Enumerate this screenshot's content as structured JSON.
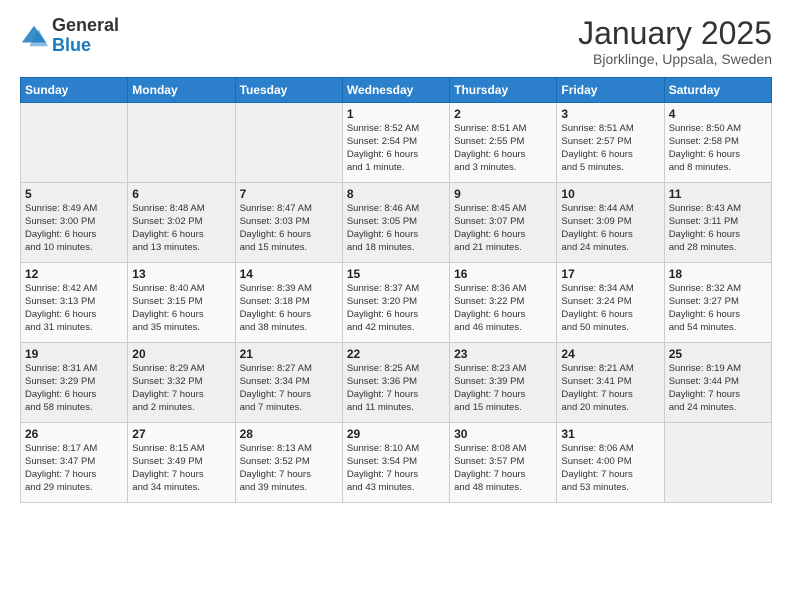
{
  "logo": {
    "general": "General",
    "blue": "Blue"
  },
  "header": {
    "title": "January 2025",
    "subtitle": "Bjorklinge, Uppsala, Sweden"
  },
  "days_of_week": [
    "Sunday",
    "Monday",
    "Tuesday",
    "Wednesday",
    "Thursday",
    "Friday",
    "Saturday"
  ],
  "weeks": [
    [
      {
        "day": "",
        "info": ""
      },
      {
        "day": "",
        "info": ""
      },
      {
        "day": "",
        "info": ""
      },
      {
        "day": "1",
        "info": "Sunrise: 8:52 AM\nSunset: 2:54 PM\nDaylight: 6 hours\nand 1 minute."
      },
      {
        "day": "2",
        "info": "Sunrise: 8:51 AM\nSunset: 2:55 PM\nDaylight: 6 hours\nand 3 minutes."
      },
      {
        "day": "3",
        "info": "Sunrise: 8:51 AM\nSunset: 2:57 PM\nDaylight: 6 hours\nand 5 minutes."
      },
      {
        "day": "4",
        "info": "Sunrise: 8:50 AM\nSunset: 2:58 PM\nDaylight: 6 hours\nand 8 minutes."
      }
    ],
    [
      {
        "day": "5",
        "info": "Sunrise: 8:49 AM\nSunset: 3:00 PM\nDaylight: 6 hours\nand 10 minutes."
      },
      {
        "day": "6",
        "info": "Sunrise: 8:48 AM\nSunset: 3:02 PM\nDaylight: 6 hours\nand 13 minutes."
      },
      {
        "day": "7",
        "info": "Sunrise: 8:47 AM\nSunset: 3:03 PM\nDaylight: 6 hours\nand 15 minutes."
      },
      {
        "day": "8",
        "info": "Sunrise: 8:46 AM\nSunset: 3:05 PM\nDaylight: 6 hours\nand 18 minutes."
      },
      {
        "day": "9",
        "info": "Sunrise: 8:45 AM\nSunset: 3:07 PM\nDaylight: 6 hours\nand 21 minutes."
      },
      {
        "day": "10",
        "info": "Sunrise: 8:44 AM\nSunset: 3:09 PM\nDaylight: 6 hours\nand 24 minutes."
      },
      {
        "day": "11",
        "info": "Sunrise: 8:43 AM\nSunset: 3:11 PM\nDaylight: 6 hours\nand 28 minutes."
      }
    ],
    [
      {
        "day": "12",
        "info": "Sunrise: 8:42 AM\nSunset: 3:13 PM\nDaylight: 6 hours\nand 31 minutes."
      },
      {
        "day": "13",
        "info": "Sunrise: 8:40 AM\nSunset: 3:15 PM\nDaylight: 6 hours\nand 35 minutes."
      },
      {
        "day": "14",
        "info": "Sunrise: 8:39 AM\nSunset: 3:18 PM\nDaylight: 6 hours\nand 38 minutes."
      },
      {
        "day": "15",
        "info": "Sunrise: 8:37 AM\nSunset: 3:20 PM\nDaylight: 6 hours\nand 42 minutes."
      },
      {
        "day": "16",
        "info": "Sunrise: 8:36 AM\nSunset: 3:22 PM\nDaylight: 6 hours\nand 46 minutes."
      },
      {
        "day": "17",
        "info": "Sunrise: 8:34 AM\nSunset: 3:24 PM\nDaylight: 6 hours\nand 50 minutes."
      },
      {
        "day": "18",
        "info": "Sunrise: 8:32 AM\nSunset: 3:27 PM\nDaylight: 6 hours\nand 54 minutes."
      }
    ],
    [
      {
        "day": "19",
        "info": "Sunrise: 8:31 AM\nSunset: 3:29 PM\nDaylight: 6 hours\nand 58 minutes."
      },
      {
        "day": "20",
        "info": "Sunrise: 8:29 AM\nSunset: 3:32 PM\nDaylight: 7 hours\nand 2 minutes."
      },
      {
        "day": "21",
        "info": "Sunrise: 8:27 AM\nSunset: 3:34 PM\nDaylight: 7 hours\nand 7 minutes."
      },
      {
        "day": "22",
        "info": "Sunrise: 8:25 AM\nSunset: 3:36 PM\nDaylight: 7 hours\nand 11 minutes."
      },
      {
        "day": "23",
        "info": "Sunrise: 8:23 AM\nSunset: 3:39 PM\nDaylight: 7 hours\nand 15 minutes."
      },
      {
        "day": "24",
        "info": "Sunrise: 8:21 AM\nSunset: 3:41 PM\nDaylight: 7 hours\nand 20 minutes."
      },
      {
        "day": "25",
        "info": "Sunrise: 8:19 AM\nSunset: 3:44 PM\nDaylight: 7 hours\nand 24 minutes."
      }
    ],
    [
      {
        "day": "26",
        "info": "Sunrise: 8:17 AM\nSunset: 3:47 PM\nDaylight: 7 hours\nand 29 minutes."
      },
      {
        "day": "27",
        "info": "Sunrise: 8:15 AM\nSunset: 3:49 PM\nDaylight: 7 hours\nand 34 minutes."
      },
      {
        "day": "28",
        "info": "Sunrise: 8:13 AM\nSunset: 3:52 PM\nDaylight: 7 hours\nand 39 minutes."
      },
      {
        "day": "29",
        "info": "Sunrise: 8:10 AM\nSunset: 3:54 PM\nDaylight: 7 hours\nand 43 minutes."
      },
      {
        "day": "30",
        "info": "Sunrise: 8:08 AM\nSunset: 3:57 PM\nDaylight: 7 hours\nand 48 minutes."
      },
      {
        "day": "31",
        "info": "Sunrise: 8:06 AM\nSunset: 4:00 PM\nDaylight: 7 hours\nand 53 minutes."
      },
      {
        "day": "",
        "info": ""
      }
    ]
  ]
}
